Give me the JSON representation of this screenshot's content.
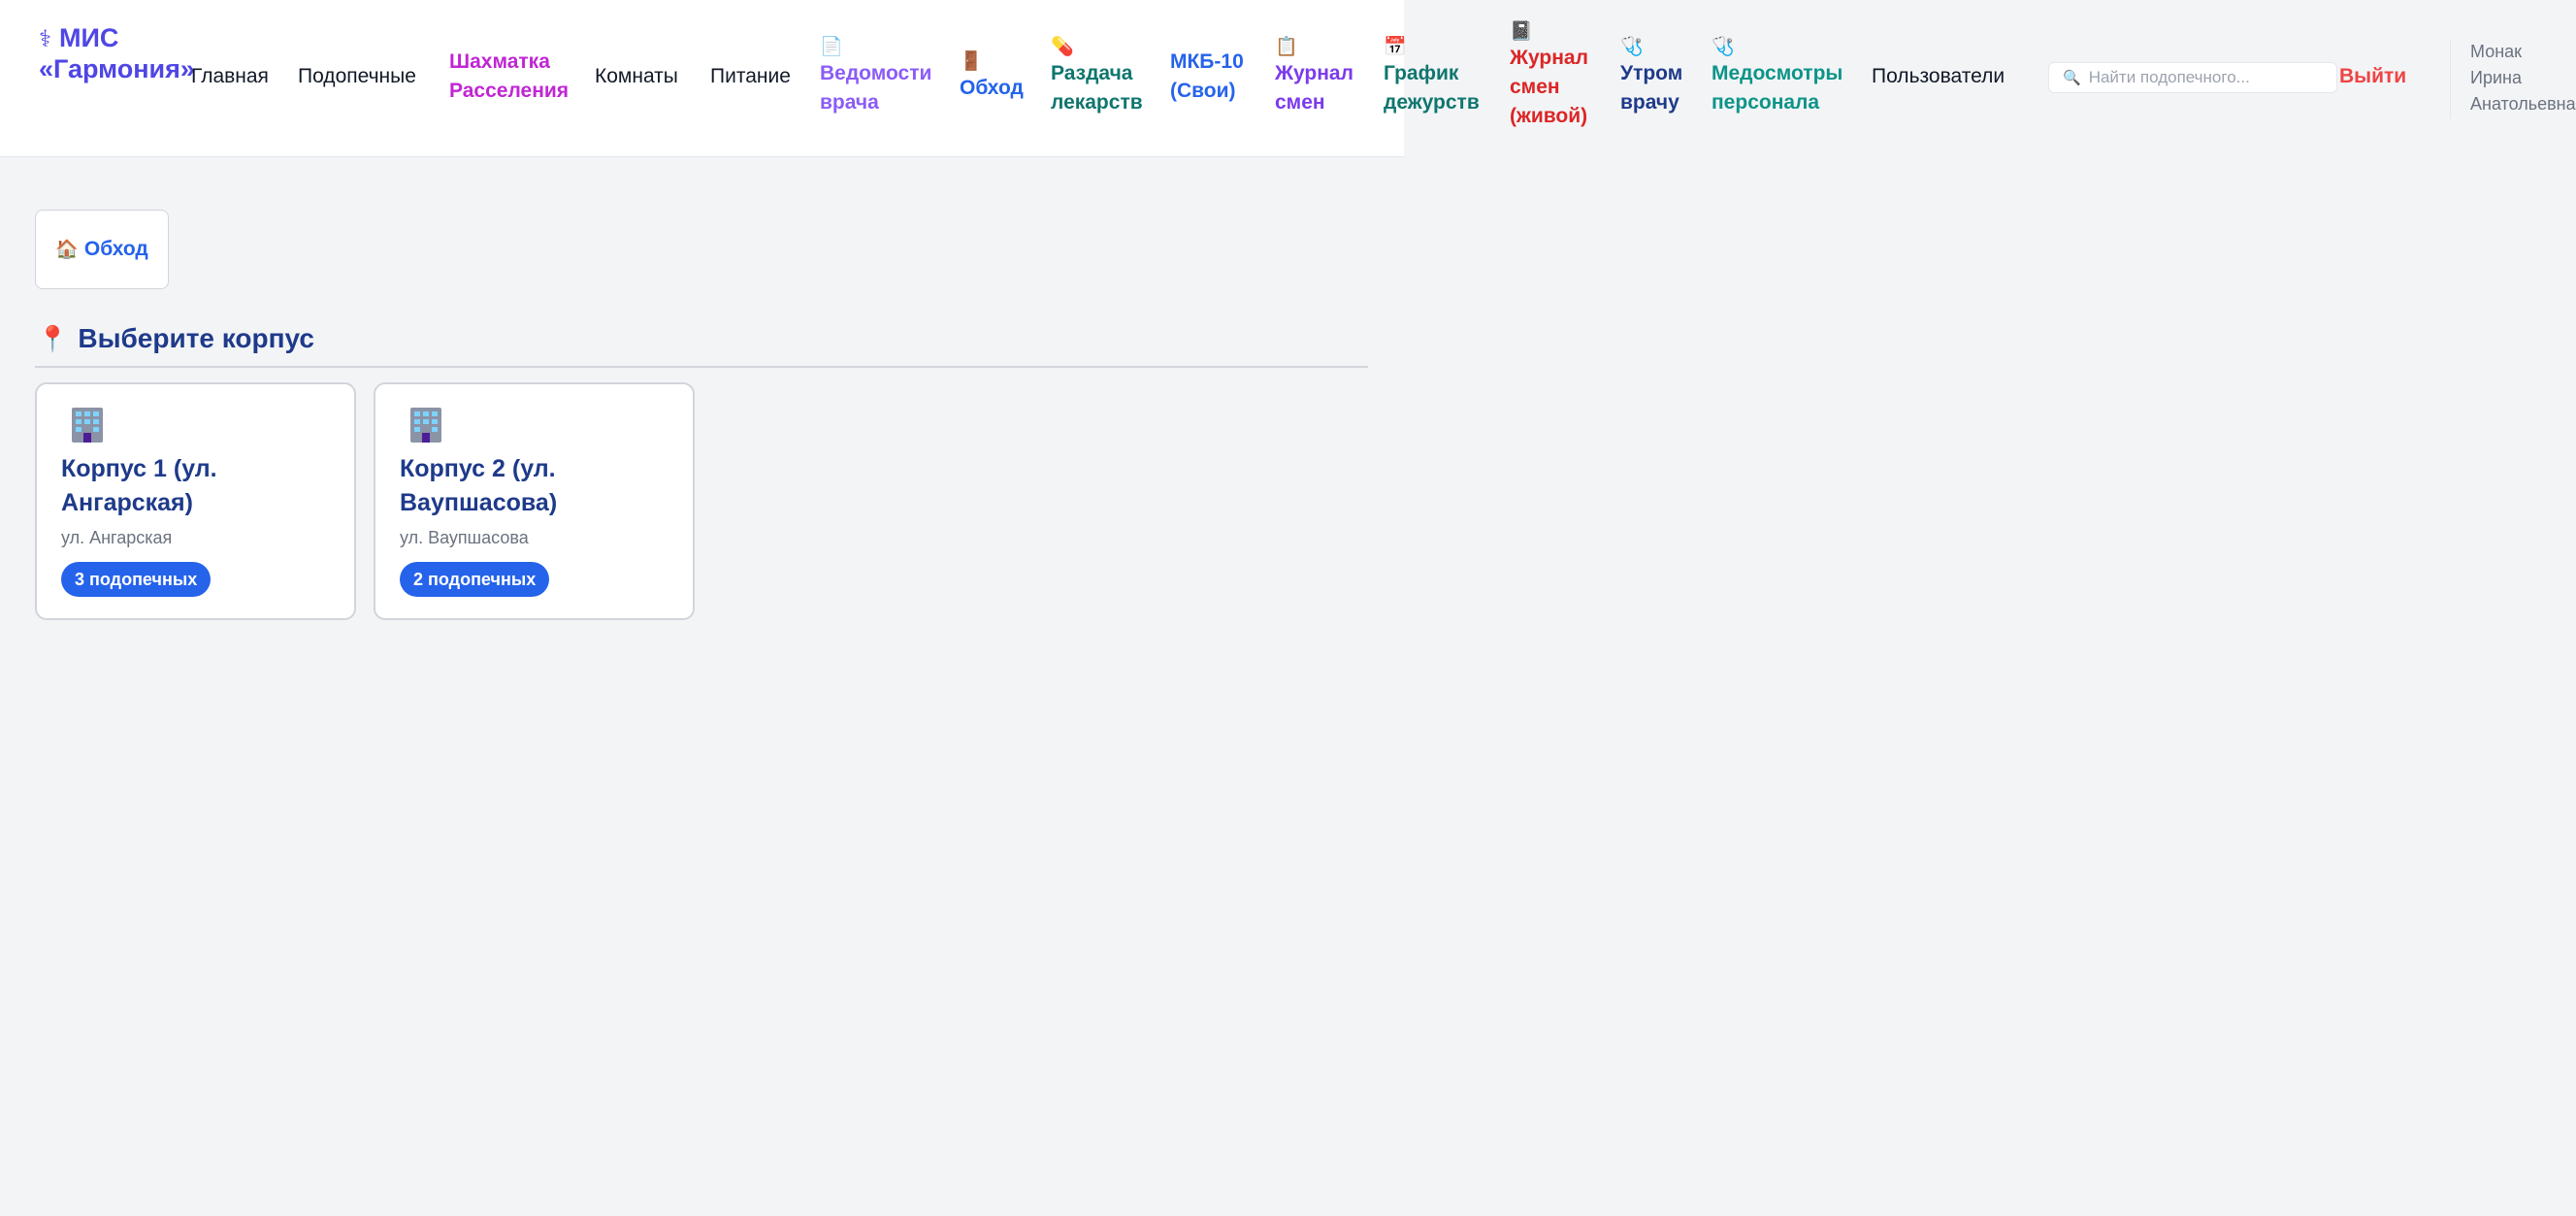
{
  "brand": {
    "line1": "МИС",
    "line2": "«Гармония»",
    "icon": "caduceus-icon"
  },
  "nav": {
    "home": "Главная",
    "wards": "Подопечные",
    "chess": {
      "line1": "Шахматка",
      "line2": "Расселения",
      "color": "#c026d3"
    },
    "rooms": "Комнаты",
    "food": "Питание",
    "doctor_sheets": {
      "line1": "Ведомости",
      "line2": "врача",
      "color": "#8b5cf6",
      "icon": "notepad-icon"
    },
    "rounds": {
      "line1": "Обход",
      "color": "#2563eb",
      "icon": "door-icon"
    },
    "meds": {
      "line1": "Раздача",
      "line2": "лекарств",
      "color": "#0f766e",
      "icon": "pill-icon"
    },
    "icd": {
      "line1": "МКБ-10",
      "line2": "(Свои)",
      "color": "#2563eb"
    },
    "shift_log": {
      "line1": "Журнал",
      "line2": "смен",
      "color": "#7c3aed",
      "icon": "clipboard-icon"
    },
    "duty": {
      "line1": "График",
      "line2": "дежурств",
      "color": "#0f766e",
      "icon": "calendar-icon"
    },
    "live_log": {
      "line1": "Журнал",
      "line2": "смен",
      "line3": "(живой)",
      "color": "#dc2626",
      "icon": "book-icon"
    },
    "morning": {
      "line1": "Утром",
      "line2": "врачу",
      "color": "#1e3a8a",
      "icon": "stethoscope-icon"
    },
    "staff_exam": {
      "line1": "Медосмотры",
      "line2": "персонала",
      "color": "#0d9488",
      "icon": "stethoscope-icon"
    },
    "users": "Пользователи"
  },
  "search": {
    "placeholder": "Найти подопечного...",
    "icon": "search-icon"
  },
  "logout": "Выйти",
  "user": {
    "last_name": "Монак",
    "first_name": "Ирина",
    "patronymic": "Анатольевна"
  },
  "breadcrumb": {
    "label": "Обход",
    "icon": "house-icon"
  },
  "section": {
    "title": "Выберите корпус",
    "icon": "pin-icon"
  },
  "buildings": [
    {
      "name": "Корпус 1 (ул. Ангарская)",
      "address": "ул. Ангарская",
      "badge": "3 подопечных"
    },
    {
      "name": "Корпус 2 (ул. Ваупшасова)",
      "address": "ул. Ваупшасова",
      "badge": "2 подопечных"
    }
  ],
  "colors": {
    "accent": "#2563eb",
    "brand": "#4f46e5",
    "danger": "#ef4444",
    "heading": "#1e3a8a"
  }
}
